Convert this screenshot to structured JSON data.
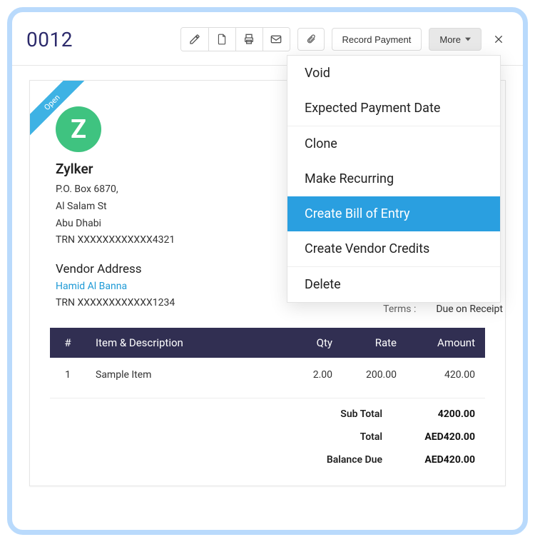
{
  "header": {
    "title": "0012",
    "record_payment_label": "Record Payment",
    "more_label": "More"
  },
  "ribbon": {
    "status": "Open"
  },
  "vendor": {
    "logo_letter": "Z",
    "name": "Zylker",
    "address_line1": "P.O. Box 6870,",
    "address_line2": "Al Salam St",
    "address_line3": "Abu Dhabi",
    "trn": "TRN XXXXXXXXXXXX4321",
    "section_label": "Vendor Address",
    "contact_name": "Hamid Al Banna",
    "contact_trn": "TRN XXXXXXXXXXXX1234"
  },
  "terms": {
    "label": "Terms :",
    "value": "Due on Receipt"
  },
  "table": {
    "headers": {
      "hash": "#",
      "item": "Item & Description",
      "qty": "Qty",
      "rate": "Rate",
      "amount": "Amount"
    },
    "rows": [
      {
        "n": "1",
        "item": "Sample Item",
        "qty": "2.00",
        "rate": "200.00",
        "amount": "420.00"
      }
    ]
  },
  "totals": {
    "subtotal_label": "Sub Total",
    "subtotal_value": "4200.00",
    "total_label": "Total",
    "total_value": "AED420.00",
    "balance_label": "Balance Due",
    "balance_value": "AED420.00"
  },
  "dropdown": {
    "void": "Void",
    "expected": "Expected Payment Date",
    "clone": "Clone",
    "recurring": "Make Recurring",
    "boe": "Create Bill of Entry",
    "credits": "Create Vendor Credits",
    "delete": "Delete"
  }
}
